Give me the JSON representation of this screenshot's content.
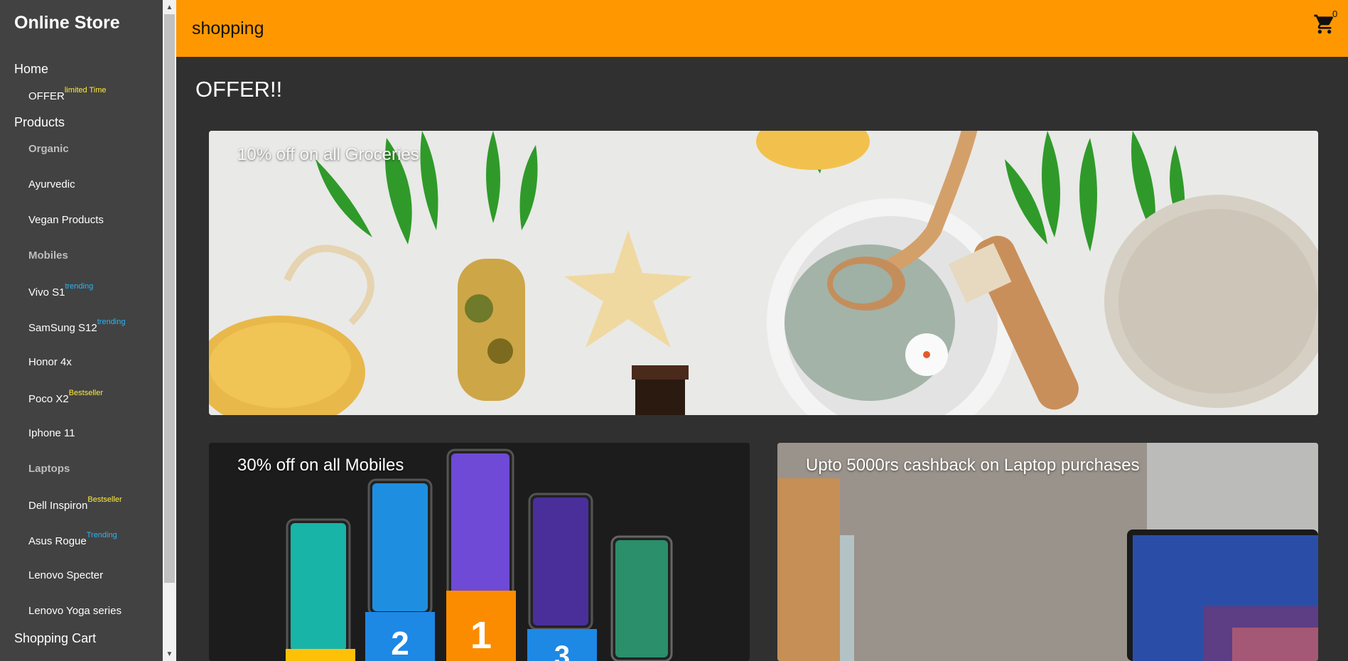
{
  "sidebar": {
    "brand": "Online Store",
    "home": "Home",
    "offer": {
      "label": "OFFER",
      "tag": "limited Time"
    },
    "products": "Products",
    "items": [
      {
        "label": "Organic",
        "kind": "category"
      },
      {
        "label": "Ayurvedic"
      },
      {
        "label": "Vegan Products"
      },
      {
        "label": "Mobiles",
        "kind": "category"
      },
      {
        "label": "Vivo S1",
        "tag": "trending"
      },
      {
        "label": "SamSung S12",
        "tag": "trending"
      },
      {
        "label": "Honor 4x"
      },
      {
        "label": "Poco X2",
        "tag": "Bestseller"
      },
      {
        "label": "Iphone 11"
      },
      {
        "label": "Laptops",
        "kind": "category"
      },
      {
        "label": "Dell Inspiron",
        "tag": "Bestseller"
      },
      {
        "label": "Asus Rogue",
        "tag": "Trending"
      },
      {
        "label": "Lenovo Specter"
      },
      {
        "label": "Lenovo Yoga series"
      }
    ],
    "cart": "Shopping Cart"
  },
  "header": {
    "title": "shopping",
    "cart_icon": "shopping-cart-icon",
    "cart_count": "0",
    "accent": "#ff9800"
  },
  "main": {
    "title": "OFFER!!",
    "offers": [
      {
        "label": "10% off on all Groceries"
      },
      {
        "label": "30% off on all Mobiles"
      },
      {
        "label": "Upto 5000rs cashback on Laptop purchases"
      }
    ],
    "podium": [
      "2",
      "1",
      "3"
    ]
  }
}
